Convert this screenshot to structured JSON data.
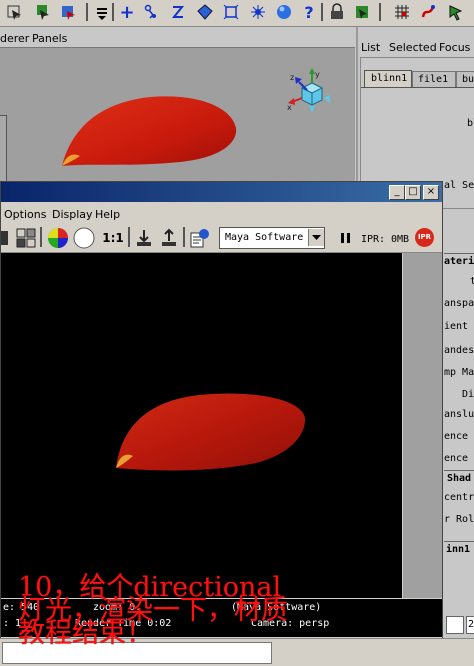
{
  "toolbar": {
    "icons": [
      "select-icon",
      "lasso-icon",
      "paint-select-icon",
      "dropdown-icon",
      "plus-icon",
      "skeleton-icon",
      "curve-icon",
      "cube-icon",
      "frame-icon",
      "star-icon",
      "sphere-icon",
      "help-icon",
      "lock-icon",
      "snap-icon",
      "grid-icon",
      "magnet-icon",
      "arrow-icon"
    ]
  },
  "viewport": {
    "menu": [
      "derer",
      "Panels"
    ]
  },
  "attribute_editor": {
    "menu": [
      "List",
      "Selected",
      "Focus"
    ],
    "tabs": [
      "blinn1",
      "file1",
      "bu"
    ],
    "node_label": "bl",
    "rows": [
      "al Se",
      "ateri",
      "t",
      "anspa",
      "ient C",
      "andesc",
      "mp Map",
      "Di",
      "anslu",
      "ence I",
      "ence I",
      "Shad",
      "centr",
      "r Rol",
      "inn1"
    ],
    "bottom_value": "2"
  },
  "render_view": {
    "window_buttons": [
      "_",
      "□",
      "×"
    ],
    "menu": [
      "Options",
      "Display",
      "Help"
    ],
    "scale_label": "1:1",
    "renderer": "Maya Software",
    "ipr_label": "IPR:",
    "ipr_size": "0MB",
    "ipr_badge": "IPR",
    "status_line1": {
      "size": "e: 540",
      "zoom": "zoom: 0.",
      "renderer": "(Maya Software)"
    },
    "status_line2": {
      "frame": ": 1",
      "render_time": "Render Time 0:02",
      "camera": "Camera: persp"
    }
  },
  "caption": {
    "line1": "10，给个directional",
    "line2": "灯光，渲染一下，材质",
    "line3": "教程结束！"
  },
  "colors": {
    "petal": "#c81a0c",
    "caption": "#ff1010",
    "titlebar": "#0a246a"
  }
}
